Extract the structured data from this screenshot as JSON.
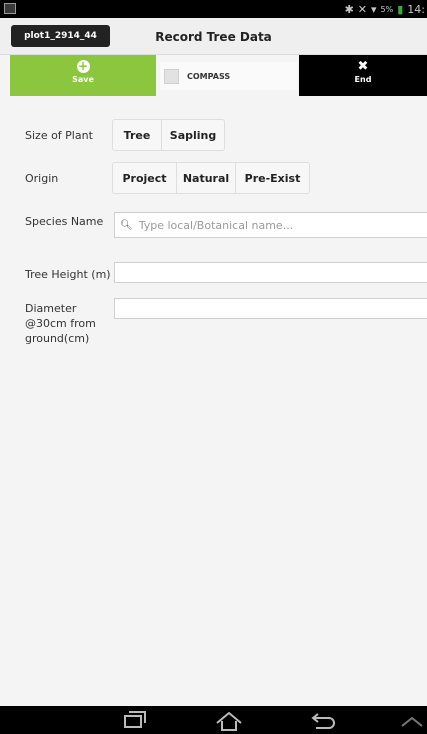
{
  "status_bar": {
    "battery_pct": "5%",
    "time": "14:"
  },
  "header": {
    "plot_id": "plot1_2914_44",
    "title": "Record Tree Data"
  },
  "actions": {
    "save_label": "Save",
    "compass_label": "COMPASS",
    "end_label": "End"
  },
  "form": {
    "size_label": "Size of Plant",
    "size_options": [
      "Tree",
      "Sapling"
    ],
    "origin_label": "Origin",
    "origin_options": [
      "Project",
      "Natural",
      "Pre-Exist"
    ],
    "species_label": "Species Name",
    "species_placeholder": "Type local/Botanical name...",
    "height_label": "Tree Height (m)",
    "height_value": "",
    "diameter_label_lines": [
      "Diameter",
      "@30cm from",
      "ground(cm)"
    ],
    "diameter_value": ""
  },
  "colors": {
    "accent": "#8cc63f",
    "end": "#000000"
  }
}
